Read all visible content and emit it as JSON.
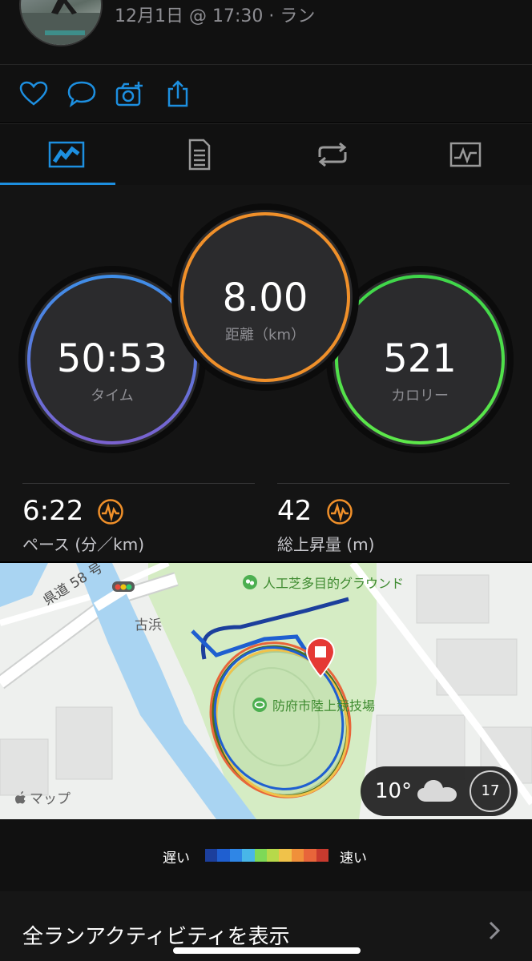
{
  "header": {
    "date_text": "12月1日 @ 17:30 · ラン"
  },
  "actions": [
    "heart-icon",
    "comment-icon",
    "camera-add-icon",
    "share-icon"
  ],
  "tabs": [
    "tab-overview",
    "tab-details",
    "tab-laps",
    "tab-charts"
  ],
  "stats": {
    "time": {
      "value": "50:53",
      "label": "タイム",
      "color": "#3f8ee8"
    },
    "distance": {
      "value": "8.00",
      "label": "距離（km）",
      "color": "#f0902a"
    },
    "calories": {
      "value": "521",
      "label": "カロリー",
      "color": "#3fd64a"
    }
  },
  "metrics": {
    "pace": {
      "value": "6:22",
      "label": "ペース (分／km)"
    },
    "elevation": {
      "value": "42",
      "label": "総上昇量 (m)"
    }
  },
  "map": {
    "road_label": "県道 58 号",
    "place_label": "古浜",
    "poi_top": "人工芝多目的グラウンド",
    "poi_stadium": "防府市陸上競技場",
    "attribution": "マップ",
    "weather_temp": "10°",
    "wind_value": "17"
  },
  "legend": {
    "slow": "遅い",
    "fast": "速い",
    "colors": [
      "#1c3f9c",
      "#1f5fd0",
      "#2f86e6",
      "#48b6e8",
      "#7ed957",
      "#b7d94a",
      "#f0c24a",
      "#f0903a",
      "#e8653a",
      "#c83a2e"
    ]
  },
  "footer": {
    "link": "全ランアクティビティを表示"
  }
}
